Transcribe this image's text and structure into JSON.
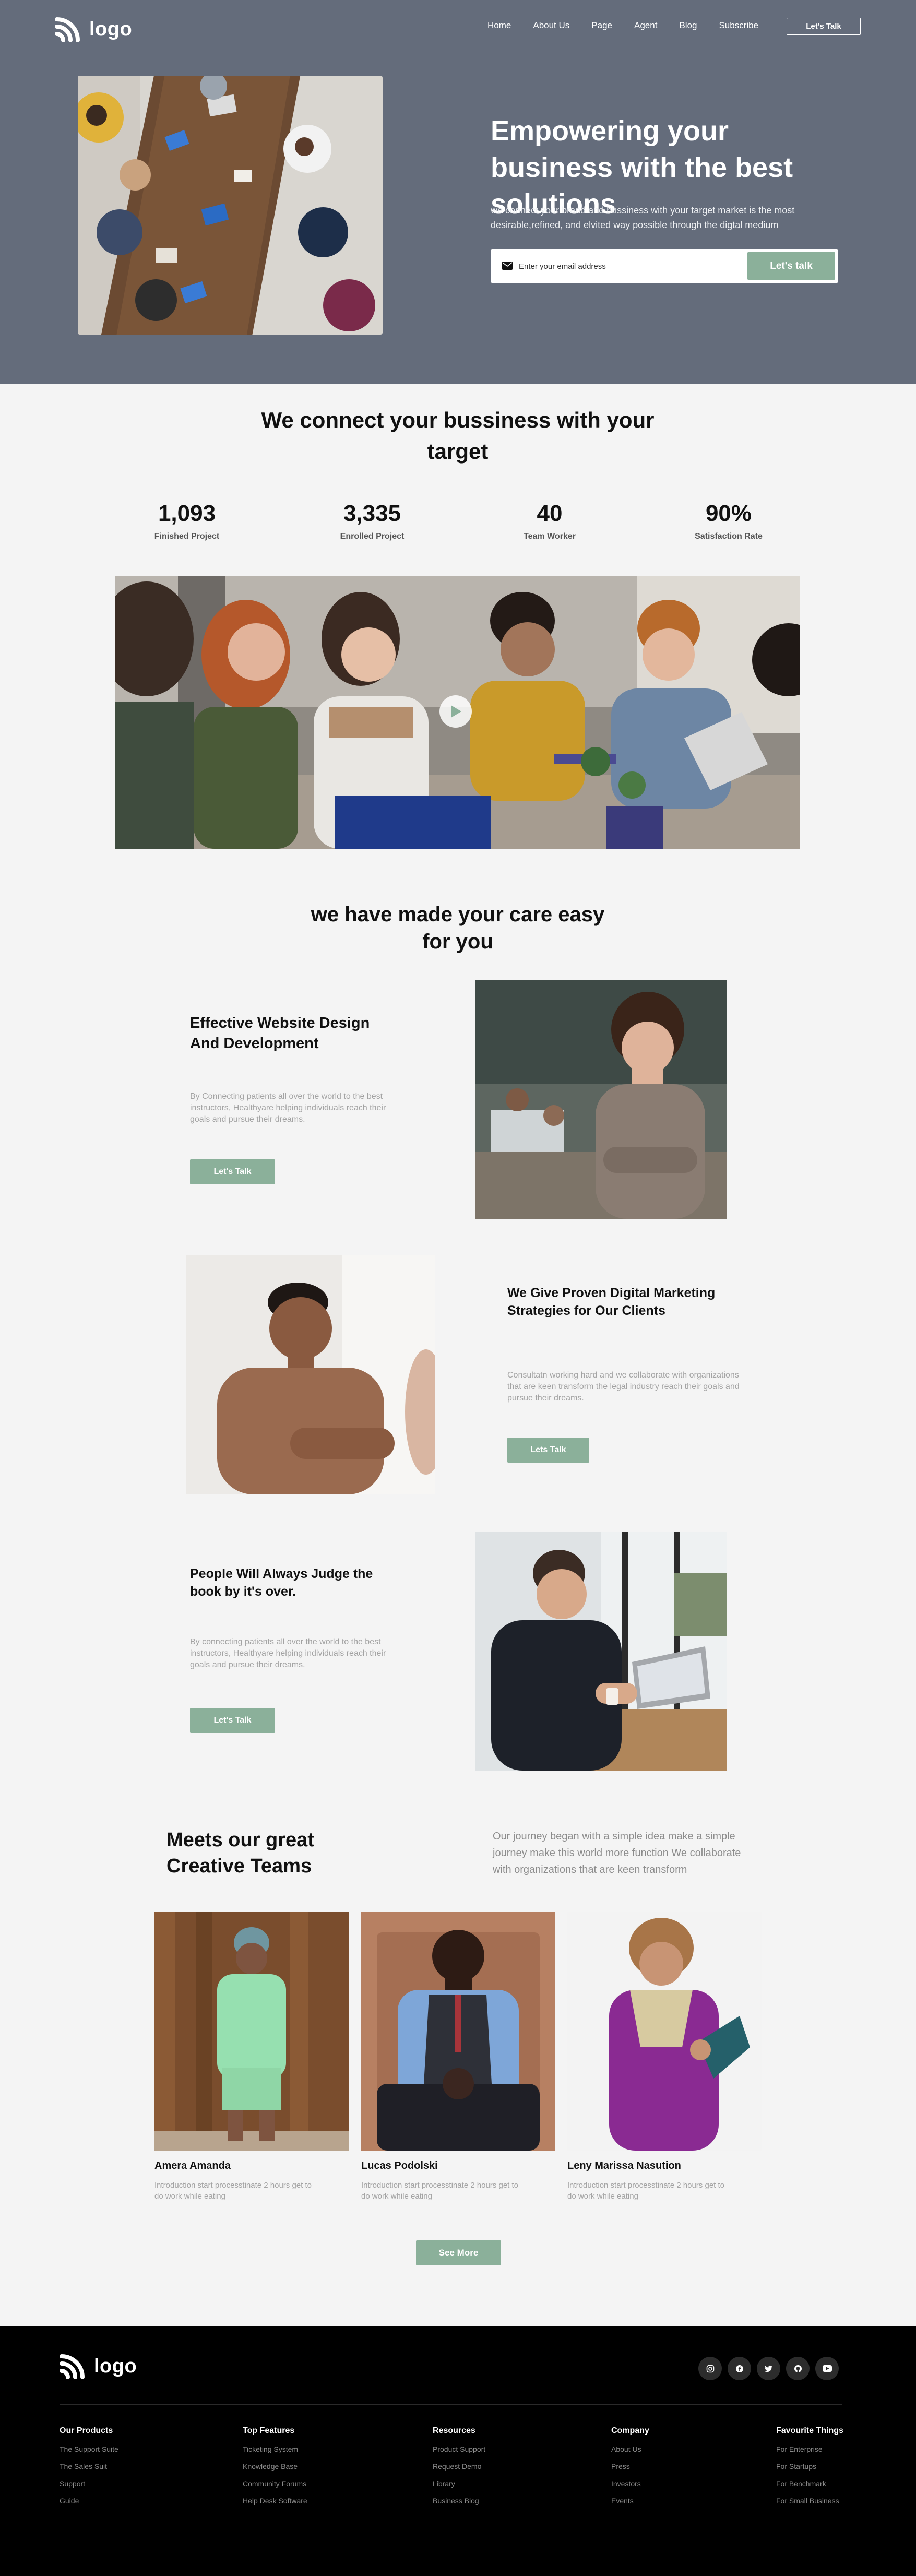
{
  "header": {
    "logo_text": "logo",
    "nav": [
      "Home",
      "About Us",
      "Page",
      "Agent",
      "Blog",
      "Subscribe"
    ],
    "cta_label": "Let's Talk"
  },
  "hero": {
    "title": "Empowering your business with the best solutions",
    "subtitle": "we connect your brand and bussiness with your target market is the most desirable,refined, and elvited way possible through the digtal medium",
    "email_placeholder": "Enter your email address",
    "button_label": "Let's talk"
  },
  "stats": {
    "title": "We connect your bussiness with your target",
    "items": [
      {
        "value": "1,093",
        "label": "Finished Project"
      },
      {
        "value": "3,335",
        "label": "Enrolled Project"
      },
      {
        "value": "40",
        "label": "Team Worker"
      },
      {
        "value": "90%",
        "label": "Satisfaction Rate"
      }
    ]
  },
  "care": {
    "title": "we have made your care easy for you",
    "features": [
      {
        "title": "Effective Website Design And Development",
        "text": "By Connecting patients all over the world to the best instructors, Healthyare helping individuals reach their goals and pursue their dreams.",
        "button": "Let's Talk"
      },
      {
        "title": "We Give Proven Digital Marketing Strategies for Our Clients",
        "text": "Consultatn working hard and we collaborate with organizations that are keen transform the legal industry reach their goals and pursue their dreams.",
        "button": "Lets Talk"
      },
      {
        "title": "People Will Always Judge the book by it's over.",
        "text": "By connecting patients all over the world to the best instructors, Healthyare helping individuals reach their goals and pursue their dreams.",
        "button": "Let's Talk"
      }
    ]
  },
  "team": {
    "title": "Meets our great Creative Teams",
    "intro": "Our journey began with a simple idea make a simple journey make this world more function We collaborate with organizations that are keen transform",
    "members": [
      {
        "name": "Amera Amanda",
        "bio": "Introduction start processtinate 2 hours get to do work while eating"
      },
      {
        "name": "Lucas Podolski",
        "bio": "Introduction start processtinate 2 hours get to do work while eating"
      },
      {
        "name": "Leny Marissa Nasution",
        "bio": "Introduction start processtinate 2 hours get to do work while eating"
      }
    ],
    "see_more": "See More"
  },
  "footer": {
    "logo_text": "logo",
    "socials": [
      "instagram-icon",
      "facebook-icon",
      "twitter-icon",
      "github-icon",
      "youtube-icon"
    ],
    "columns": [
      {
        "title": "Our Products",
        "links": [
          "The Support Suite",
          "The Sales Suit",
          "Support",
          "Guide"
        ]
      },
      {
        "title": "Top Features",
        "links": [
          "Ticketing System",
          "Knowledge Base",
          "Community Forums",
          "Help Desk Software"
        ]
      },
      {
        "title": "Resources",
        "links": [
          "Product Support",
          "Request Demo",
          "Library",
          "Business Blog"
        ]
      },
      {
        "title": "Company",
        "links": [
          "About Us",
          "Press",
          "Investors",
          "Events"
        ]
      },
      {
        "title": "Favourite Things",
        "links": [
          "For Enterprise",
          "For Startups",
          "For Benchmark",
          "For Small Business"
        ]
      }
    ]
  },
  "colors": {
    "hero_bg": "#646c7b",
    "accent_green": "#8bb09a",
    "footer_bg": "#000000",
    "page_bg": "#f4f4f4"
  }
}
